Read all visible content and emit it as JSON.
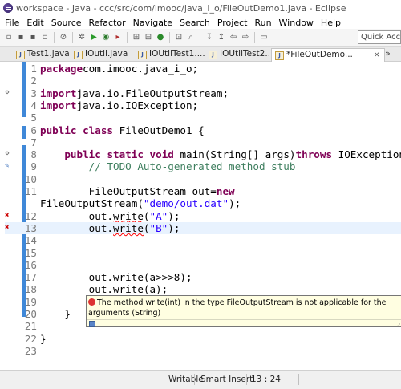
{
  "window": {
    "title": "workspace - Java - ccc/src/com/imooc/java_i_o/FileOutDemo1.java - Eclipse"
  },
  "menu": [
    "File",
    "Edit",
    "Source",
    "Refactor",
    "Navigate",
    "Search",
    "Project",
    "Run",
    "Window",
    "Help"
  ],
  "toolbar": {
    "quick_access": "Quick Access"
  },
  "tabs": [
    {
      "label": "Test1.java"
    },
    {
      "label": "IOutil.java"
    },
    {
      "label": "IOUtilTest1...."
    },
    {
      "label": "IOUtilTest2...."
    },
    {
      "label": "*FileOutDemo...",
      "active": true,
      "close": "×"
    }
  ],
  "tab_overflow": "»",
  "editor": {
    "lines": [
      {
        "n": "1",
        "tokens": [
          [
            "kw",
            "package"
          ],
          [
            "",
            "com.imooc.java_i_o;"
          ]
        ]
      },
      {
        "n": "2",
        "tokens": []
      },
      {
        "n": "3",
        "fold": "⊕",
        "tokens": [
          [
            "kw",
            "import"
          ],
          [
            "",
            "java.io.FileOutputStream;"
          ]
        ]
      },
      {
        "n": "4",
        "tokens": [
          [
            "kw",
            "import"
          ],
          [
            "",
            "java.io.IOException;"
          ]
        ]
      },
      {
        "n": "5",
        "tokens": []
      },
      {
        "n": "6",
        "tokens": [
          [
            "kw",
            "public"
          ],
          [
            "",
            " "
          ],
          [
            "kw",
            "class"
          ],
          [
            "",
            " FileOutDemo1 {"
          ]
        ]
      },
      {
        "n": "7",
        "tokens": []
      },
      {
        "n": "8",
        "fold": "⊖",
        "tokens": [
          [
            "",
            "    "
          ],
          [
            "kw",
            "public"
          ],
          [
            "",
            " "
          ],
          [
            "kw",
            "static"
          ],
          [
            "",
            " "
          ],
          [
            "kw",
            "void"
          ],
          [
            "",
            " main(String[] args)"
          ],
          [
            "kw",
            "throws"
          ],
          [
            "",
            " IOException"
          ]
        ]
      },
      {
        "n": "9",
        "marker": "task",
        "tokens": [
          [
            "",
            "        "
          ],
          [
            "cmt",
            "// TODO Auto-generated method stub"
          ]
        ]
      },
      {
        "n": "10",
        "tokens": []
      },
      {
        "n": "11",
        "tokens": [
          [
            "",
            "        FileOutputStream out="
          ],
          [
            "kw",
            "new"
          ]
        ]
      },
      {
        "n": "",
        "tokens": [
          [
            "",
            "FileOutputStream("
          ],
          [
            "str",
            "\"demo/out.dat\""
          ],
          [
            "",
            ");"
          ]
        ]
      },
      {
        "n": "12",
        "marker": "error",
        "tokens": [
          [
            "",
            "        out."
          ],
          [
            "err",
            "write"
          ],
          [
            "",
            "("
          ],
          [
            "str",
            "\"A\""
          ],
          [
            "",
            ");"
          ]
        ]
      },
      {
        "n": "13",
        "marker": "error",
        "current": true,
        "tokens": [
          [
            "",
            "        out."
          ],
          [
            "err",
            "write"
          ],
          [
            "",
            "("
          ],
          [
            "str",
            "\"B\""
          ],
          [
            "",
            ");"
          ]
        ]
      },
      {
        "n": "14",
        "tokens": []
      },
      {
        "n": "15",
        "tokens": []
      },
      {
        "n": "16",
        "tokens": []
      },
      {
        "n": "17",
        "tokens": [
          [
            "",
            "        out.write(a>>>8);"
          ]
        ]
      },
      {
        "n": "18",
        "tokens": [
          [
            "",
            "        out.write(a);"
          ]
        ]
      },
      {
        "n": "19",
        "tokens": []
      },
      {
        "n": "20",
        "tokens": [
          [
            "",
            "    }"
          ]
        ]
      },
      {
        "n": "21",
        "tokens": []
      },
      {
        "n": "22",
        "tokens": [
          [
            "",
            "}"
          ]
        ]
      },
      {
        "n": "23",
        "tokens": []
      }
    ]
  },
  "error_popup": {
    "message": "The method write(int) in the type FileOutputStream is not applicable for the arguments (String)"
  },
  "status": {
    "mode": "Writable",
    "insert": "Smart Insert",
    "position": "13 : 24"
  }
}
